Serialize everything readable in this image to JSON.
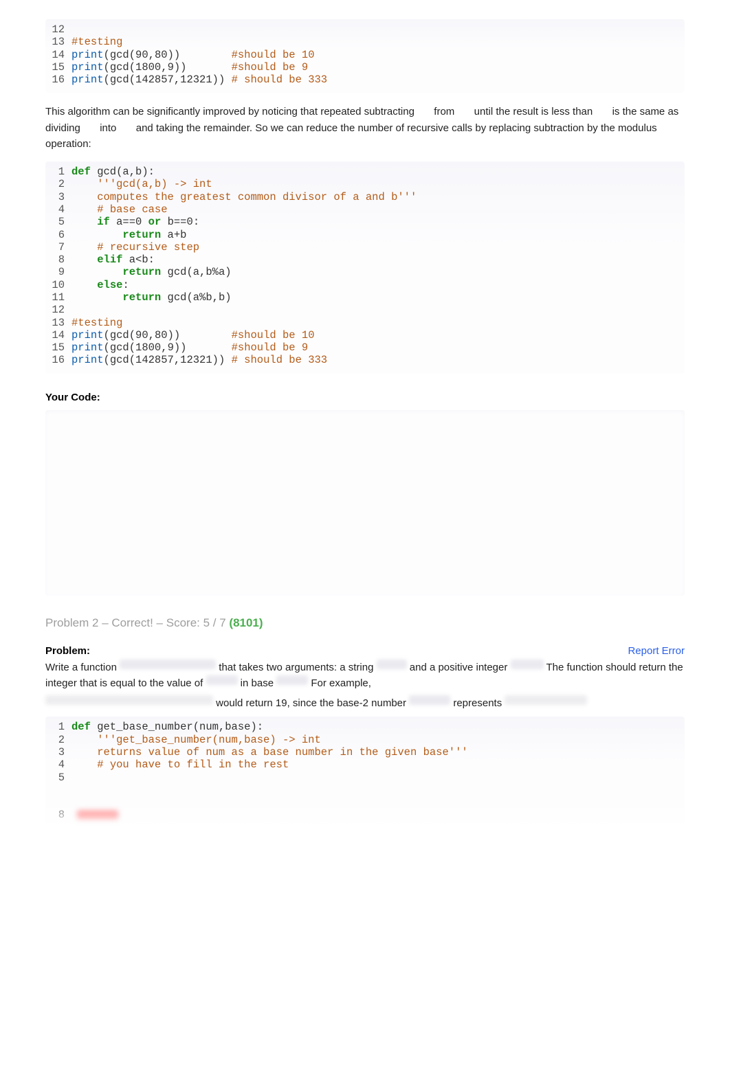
{
  "code1": {
    "lines": [
      {
        "n": "12",
        "tokens": []
      },
      {
        "n": "13",
        "tokens": [
          {
            "c": "k-com",
            "t": "#testing"
          }
        ]
      },
      {
        "n": "14",
        "tokens": [
          {
            "c": "k-fn",
            "t": "print"
          },
          {
            "c": "k-txt",
            "t": "(gcd("
          },
          {
            "c": "k-num",
            "t": "90"
          },
          {
            "c": "k-txt",
            "t": ","
          },
          {
            "c": "k-num",
            "t": "80"
          },
          {
            "c": "k-txt",
            "t": "))        "
          },
          {
            "c": "k-com",
            "t": "#should be 10"
          }
        ]
      },
      {
        "n": "15",
        "tokens": [
          {
            "c": "k-fn",
            "t": "print"
          },
          {
            "c": "k-txt",
            "t": "(gcd("
          },
          {
            "c": "k-num",
            "t": "1800"
          },
          {
            "c": "k-txt",
            "t": ","
          },
          {
            "c": "k-num",
            "t": "9"
          },
          {
            "c": "k-txt",
            "t": "))       "
          },
          {
            "c": "k-com",
            "t": "#should be 9"
          }
        ]
      },
      {
        "n": "16",
        "tokens": [
          {
            "c": "k-fn",
            "t": "print"
          },
          {
            "c": "k-txt",
            "t": "(gcd("
          },
          {
            "c": "k-num",
            "t": "142857"
          },
          {
            "c": "k-txt",
            "t": ","
          },
          {
            "c": "k-num",
            "t": "12321"
          },
          {
            "c": "k-txt",
            "t": ")) "
          },
          {
            "c": "k-com",
            "t": "# should be 333"
          }
        ]
      }
    ]
  },
  "para1_a": "This algorithm can be significantly improved by noticing that repeated subtracting",
  "para1_b": "from",
  "para1_c": "until the result is less than",
  "para1_d": "is the same as dividing",
  "para1_e": "into",
  "para1_f": "and taking the remainder. So we can reduce the number of recursive calls by replacing subtraction by the modulus operation:",
  "code2": {
    "lines": [
      {
        "n": "1",
        "tokens": [
          {
            "c": "k-def",
            "t": "def"
          },
          {
            "c": "k-txt",
            "t": " gcd(a,b):"
          }
        ]
      },
      {
        "n": "2",
        "tokens": [
          {
            "c": "k-txt",
            "t": "    "
          },
          {
            "c": "k-str",
            "t": "'''gcd(a,b) -> int"
          }
        ]
      },
      {
        "n": "3",
        "tokens": [
          {
            "c": "k-str",
            "t": "    computes the greatest common divisor of a and b'''"
          }
        ]
      },
      {
        "n": "4",
        "tokens": [
          {
            "c": "k-txt",
            "t": "    "
          },
          {
            "c": "k-com",
            "t": "# base case"
          }
        ]
      },
      {
        "n": "5",
        "tokens": [
          {
            "c": "k-txt",
            "t": "    "
          },
          {
            "c": "k-kw",
            "t": "if"
          },
          {
            "c": "k-txt",
            "t": " a=="
          },
          {
            "c": "k-num",
            "t": "0"
          },
          {
            "c": "k-txt",
            "t": " "
          },
          {
            "c": "k-kw",
            "t": "or"
          },
          {
            "c": "k-txt",
            "t": " b=="
          },
          {
            "c": "k-num",
            "t": "0"
          },
          {
            "c": "k-txt",
            "t": ":"
          }
        ]
      },
      {
        "n": "6",
        "tokens": [
          {
            "c": "k-txt",
            "t": "        "
          },
          {
            "c": "k-kw",
            "t": "return"
          },
          {
            "c": "k-txt",
            "t": " a+b"
          }
        ]
      },
      {
        "n": "7",
        "tokens": [
          {
            "c": "k-txt",
            "t": "    "
          },
          {
            "c": "k-com",
            "t": "# recursive step"
          }
        ]
      },
      {
        "n": "8",
        "tokens": [
          {
            "c": "k-txt",
            "t": "    "
          },
          {
            "c": "k-kw",
            "t": "elif"
          },
          {
            "c": "k-txt",
            "t": " a<b:"
          }
        ]
      },
      {
        "n": "9",
        "tokens": [
          {
            "c": "k-txt",
            "t": "        "
          },
          {
            "c": "k-kw",
            "t": "return"
          },
          {
            "c": "k-txt",
            "t": " gcd(a,b%a)"
          }
        ]
      },
      {
        "n": "10",
        "tokens": [
          {
            "c": "k-txt",
            "t": "    "
          },
          {
            "c": "k-kw",
            "t": "else"
          },
          {
            "c": "k-txt",
            "t": ":"
          }
        ]
      },
      {
        "n": "11",
        "tokens": [
          {
            "c": "k-txt",
            "t": "        "
          },
          {
            "c": "k-kw",
            "t": "return"
          },
          {
            "c": "k-txt",
            "t": " gcd(a%b,b)"
          }
        ]
      },
      {
        "n": "12",
        "tokens": []
      },
      {
        "n": "13",
        "tokens": [
          {
            "c": "k-com",
            "t": "#testing"
          }
        ]
      },
      {
        "n": "14",
        "tokens": [
          {
            "c": "k-fn",
            "t": "print"
          },
          {
            "c": "k-txt",
            "t": "(gcd("
          },
          {
            "c": "k-num",
            "t": "90"
          },
          {
            "c": "k-txt",
            "t": ","
          },
          {
            "c": "k-num",
            "t": "80"
          },
          {
            "c": "k-txt",
            "t": "))        "
          },
          {
            "c": "k-com",
            "t": "#should be 10"
          }
        ]
      },
      {
        "n": "15",
        "tokens": [
          {
            "c": "k-fn",
            "t": "print"
          },
          {
            "c": "k-txt",
            "t": "(gcd("
          },
          {
            "c": "k-num",
            "t": "1800"
          },
          {
            "c": "k-txt",
            "t": ","
          },
          {
            "c": "k-num",
            "t": "9"
          },
          {
            "c": "k-txt",
            "t": "))       "
          },
          {
            "c": "k-com",
            "t": "#should be 9"
          }
        ]
      },
      {
        "n": "16",
        "tokens": [
          {
            "c": "k-fn",
            "t": "print"
          },
          {
            "c": "k-txt",
            "t": "(gcd("
          },
          {
            "c": "k-num",
            "t": "142857"
          },
          {
            "c": "k-txt",
            "t": ","
          },
          {
            "c": "k-num",
            "t": "12321"
          },
          {
            "c": "k-txt",
            "t": ")) "
          },
          {
            "c": "k-com",
            "t": "# should be 333"
          }
        ]
      }
    ]
  },
  "your_code_label": "Your Code:",
  "problem_title_a": "Problem 2 – Correct! – Score: 5 / 7 ",
  "problem_title_b": "(8101)",
  "problem_label": "Problem:",
  "report_error": "Report Error",
  "ptext": {
    "a": "Write a function",
    "b": "that takes two arguments: a string",
    "c": "and a positive integer",
    "d": "The function should return the integer that is equal to the value of",
    "e": "in base",
    "f": "For example,",
    "g": "would return 19, since the base-2 number",
    "h": "represents"
  },
  "code3": {
    "lines": [
      {
        "n": "1",
        "tokens": [
          {
            "c": "k-def",
            "t": "def"
          },
          {
            "c": "k-txt",
            "t": " get_base_number(num,base):"
          }
        ]
      },
      {
        "n": "2",
        "tokens": [
          {
            "c": "k-txt",
            "t": "    "
          },
          {
            "c": "k-str",
            "t": "'''get_base_number(num,base) -> int"
          }
        ]
      },
      {
        "n": "3",
        "tokens": [
          {
            "c": "k-str",
            "t": "    returns value of num as a base number in the given base'''"
          }
        ]
      },
      {
        "n": "4",
        "tokens": [
          {
            "c": "k-txt",
            "t": "    "
          },
          {
            "c": "k-com",
            "t": "# you have to fill in the rest"
          }
        ]
      },
      {
        "n": "5",
        "tokens": []
      },
      {
        "n": "",
        "tokens": []
      },
      {
        "n": "",
        "tokens": []
      },
      {
        "n": "8",
        "tokens": []
      }
    ]
  }
}
